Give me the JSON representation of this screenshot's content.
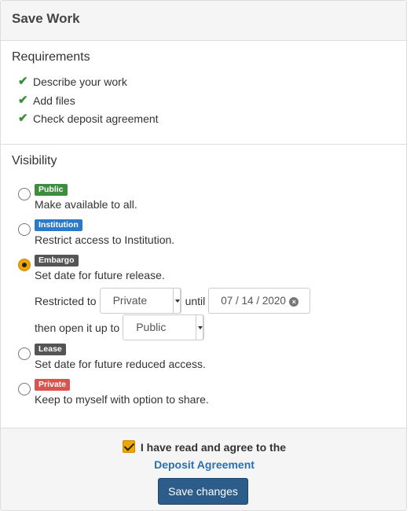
{
  "panel": {
    "title": "Save Work"
  },
  "requirements": {
    "heading": "Requirements",
    "items": [
      "Describe your work",
      "Add files",
      "Check deposit agreement"
    ]
  },
  "visibility": {
    "heading": "Visibility",
    "options": [
      {
        "badge": "Public",
        "description": "Make available to all.",
        "color": "#3c8e3c",
        "selected": false
      },
      {
        "badge": "Institution",
        "description": "Restrict access to Institution.",
        "color": "#2a7ac9",
        "selected": false
      },
      {
        "badge": "Embargo",
        "description": "Set date for future release.",
        "color": "#555555",
        "selected": true
      },
      {
        "badge": "Lease",
        "description": "Set date for future reduced access.",
        "color": "#555555",
        "selected": false
      },
      {
        "badge": "Private",
        "description": "Keep to myself with option to share.",
        "color": "#d9534f",
        "selected": false
      }
    ],
    "embargo": {
      "restricted_label": "Restricted to",
      "restricted_value": "Private",
      "until_label": "until",
      "date_value": "07 / 14 / 2020",
      "then_label": "then open it up to",
      "then_value": "Public"
    }
  },
  "footer": {
    "agree_text": "I have read and agree to the",
    "agreement_link": "Deposit Agreement",
    "save_label": "Save changes",
    "agreed": true
  }
}
